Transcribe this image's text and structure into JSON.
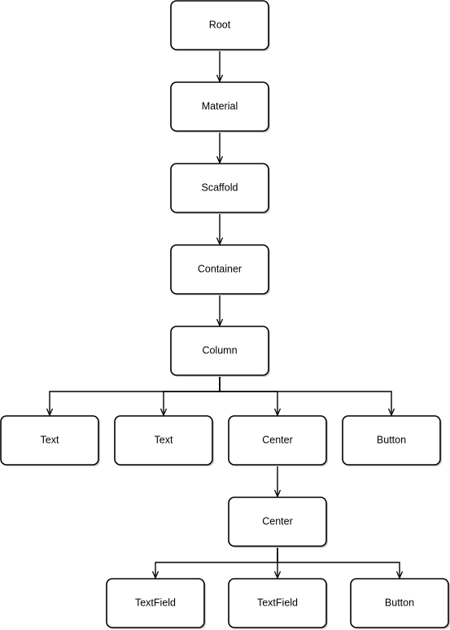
{
  "diagram": {
    "type": "tree",
    "nodes": [
      {
        "id": "root",
        "label": "Root"
      },
      {
        "id": "material",
        "label": "Material"
      },
      {
        "id": "scaffold",
        "label": "Scaffold"
      },
      {
        "id": "container",
        "label": "Container"
      },
      {
        "id": "column",
        "label": "Column"
      },
      {
        "id": "text1",
        "label": "Text"
      },
      {
        "id": "text2",
        "label": "Text"
      },
      {
        "id": "center1",
        "label": "Center"
      },
      {
        "id": "button1",
        "label": "Button"
      },
      {
        "id": "center2",
        "label": "Center"
      },
      {
        "id": "textfield1",
        "label": "TextField"
      },
      {
        "id": "textfield2",
        "label": "TextField"
      },
      {
        "id": "button2",
        "label": "Button"
      }
    ],
    "edges": [
      [
        "root",
        "material"
      ],
      [
        "material",
        "scaffold"
      ],
      [
        "scaffold",
        "container"
      ],
      [
        "container",
        "column"
      ],
      [
        "column",
        "text1"
      ],
      [
        "column",
        "text2"
      ],
      [
        "column",
        "center1"
      ],
      [
        "column",
        "button1"
      ],
      [
        "center1",
        "center2"
      ],
      [
        "center2",
        "textfield1"
      ],
      [
        "center2",
        "textfield2"
      ],
      [
        "center2",
        "button2"
      ]
    ]
  }
}
